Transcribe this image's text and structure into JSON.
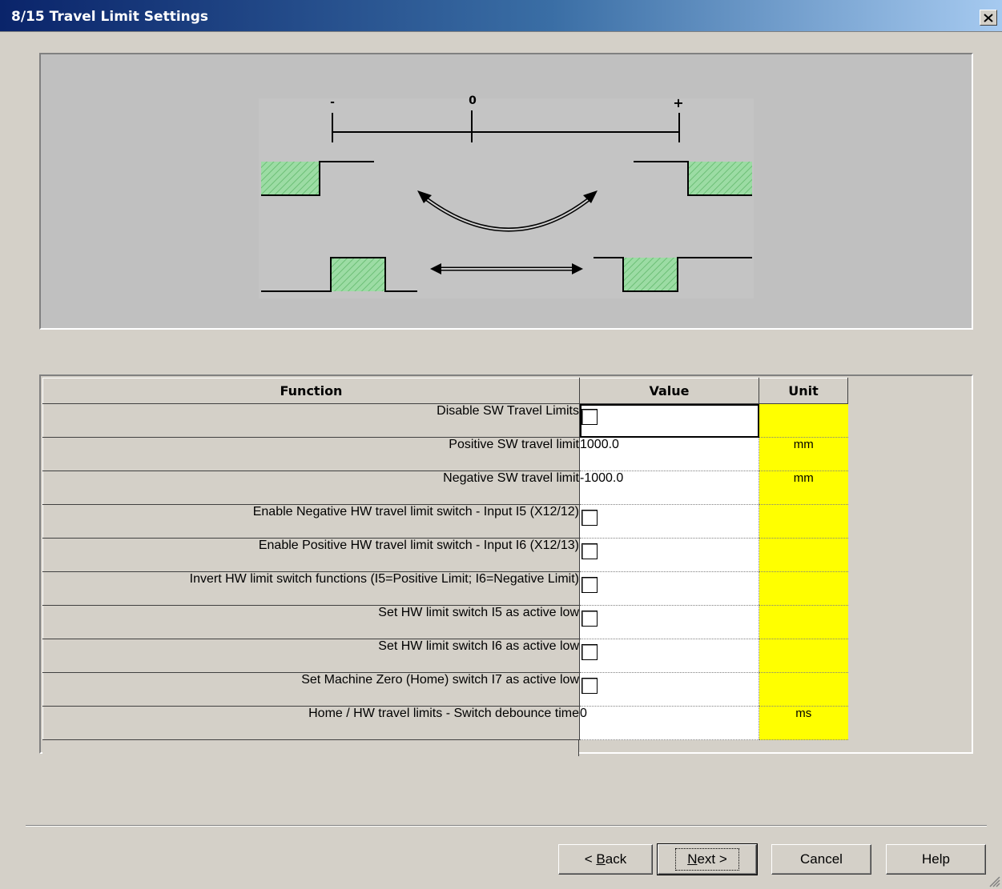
{
  "window": {
    "title": "8/15 Travel Limit Settings",
    "close_icon": "close-icon"
  },
  "diagram": {
    "axis_labels": {
      "negative": "-",
      "zero": "0",
      "positive": "+"
    },
    "fill_color": "#8fd49a"
  },
  "table": {
    "headers": {
      "function": "Function",
      "value": "Value",
      "unit": "Unit"
    },
    "rows": [
      {
        "function": "Disable SW Travel Limits",
        "type": "checkbox",
        "value": "",
        "unit": ""
      },
      {
        "function": "Positive SW travel limit",
        "type": "text",
        "value": "1000.0",
        "unit": "mm"
      },
      {
        "function": "Negative SW travel limit",
        "type": "text",
        "value": "-1000.0",
        "unit": "mm"
      },
      {
        "function": "Enable Negative HW travel limit switch - Input I5 (X12/12)",
        "type": "checkbox",
        "value": "",
        "unit": ""
      },
      {
        "function": "Enable Positive HW travel limit switch - Input I6 (X12/13)",
        "type": "checkbox",
        "value": "",
        "unit": ""
      },
      {
        "function": "Invert HW limit switch functions (I5=Positive Limit; I6=Negative Limit)",
        "type": "checkbox",
        "value": "",
        "unit": ""
      },
      {
        "function": "Set HW limit switch I5 as active low",
        "type": "checkbox",
        "value": "",
        "unit": ""
      },
      {
        "function": "Set HW limit switch I6 as active low",
        "type": "checkbox",
        "value": "",
        "unit": ""
      },
      {
        "function": "Set Machine Zero (Home) switch I7 as active low",
        "type": "checkbox",
        "value": "",
        "unit": ""
      },
      {
        "function": "Home / HW travel limits - Switch debounce time",
        "type": "text",
        "value": "0",
        "unit": "ms"
      }
    ],
    "unit_color": "#ffff00"
  },
  "buttons": {
    "back": {
      "prefix": "< ",
      "mnemonic": "B",
      "rest": "ack"
    },
    "next": {
      "mnemonic": "N",
      "rest": "ext >"
    },
    "cancel": "Cancel",
    "help": "Help"
  }
}
